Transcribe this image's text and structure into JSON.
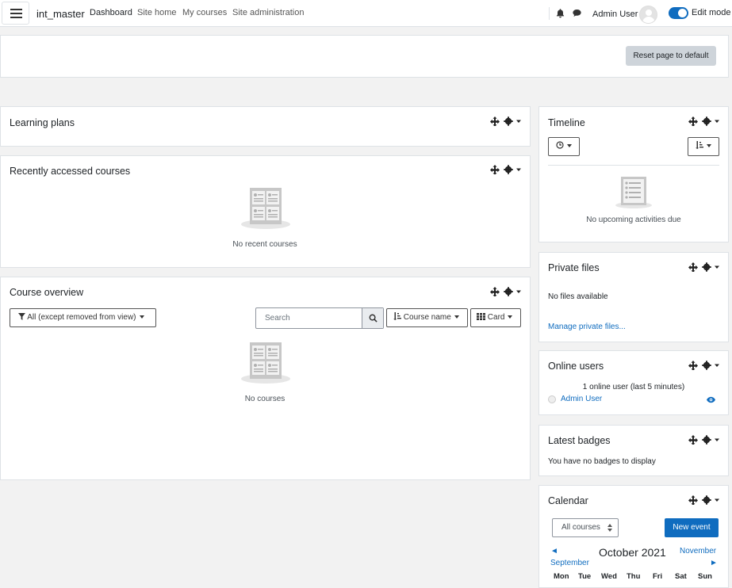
{
  "nav": {
    "brand": "int_master",
    "links": [
      "Dashboard",
      "Site home",
      "My courses",
      "Site administration"
    ],
    "user_name": "Admin User",
    "edit_mode_label": "Edit mode",
    "edit_mode_on": true
  },
  "top": {
    "reset_button": "Reset page to default"
  },
  "blocks": {
    "learning_plans": {
      "title": "Learning plans"
    },
    "recent_courses": {
      "title": "Recently accessed courses",
      "empty": "No recent courses"
    },
    "course_overview": {
      "title": "Course overview",
      "filter": "All (except removed from view)",
      "search_placeholder": "Search",
      "sort": "Course name",
      "view": "Card",
      "empty": "No courses"
    },
    "timeline": {
      "title": "Timeline",
      "empty": "No upcoming activities due"
    },
    "private_files": {
      "title": "Private files",
      "empty": "No files available",
      "manage_link": "Manage private files..."
    },
    "online_users": {
      "title": "Online users",
      "summary": "1 online user (last 5 minutes)",
      "users": [
        "Admin User"
      ]
    },
    "latest_badges": {
      "title": "Latest badges",
      "empty": "You have no badges to display"
    },
    "calendar": {
      "title": "Calendar",
      "course_select": "All courses",
      "new_event": "New event",
      "month": "October 2021",
      "prev": "September",
      "next": "November",
      "days": [
        "Mon",
        "Tue",
        "Wed",
        "Thu",
        "Fri",
        "Sat",
        "Sun"
      ]
    }
  },
  "colors": {
    "primary": "#0f6cbf",
    "secondary": "#ced4da",
    "page_bg": "#f2f2f2"
  }
}
